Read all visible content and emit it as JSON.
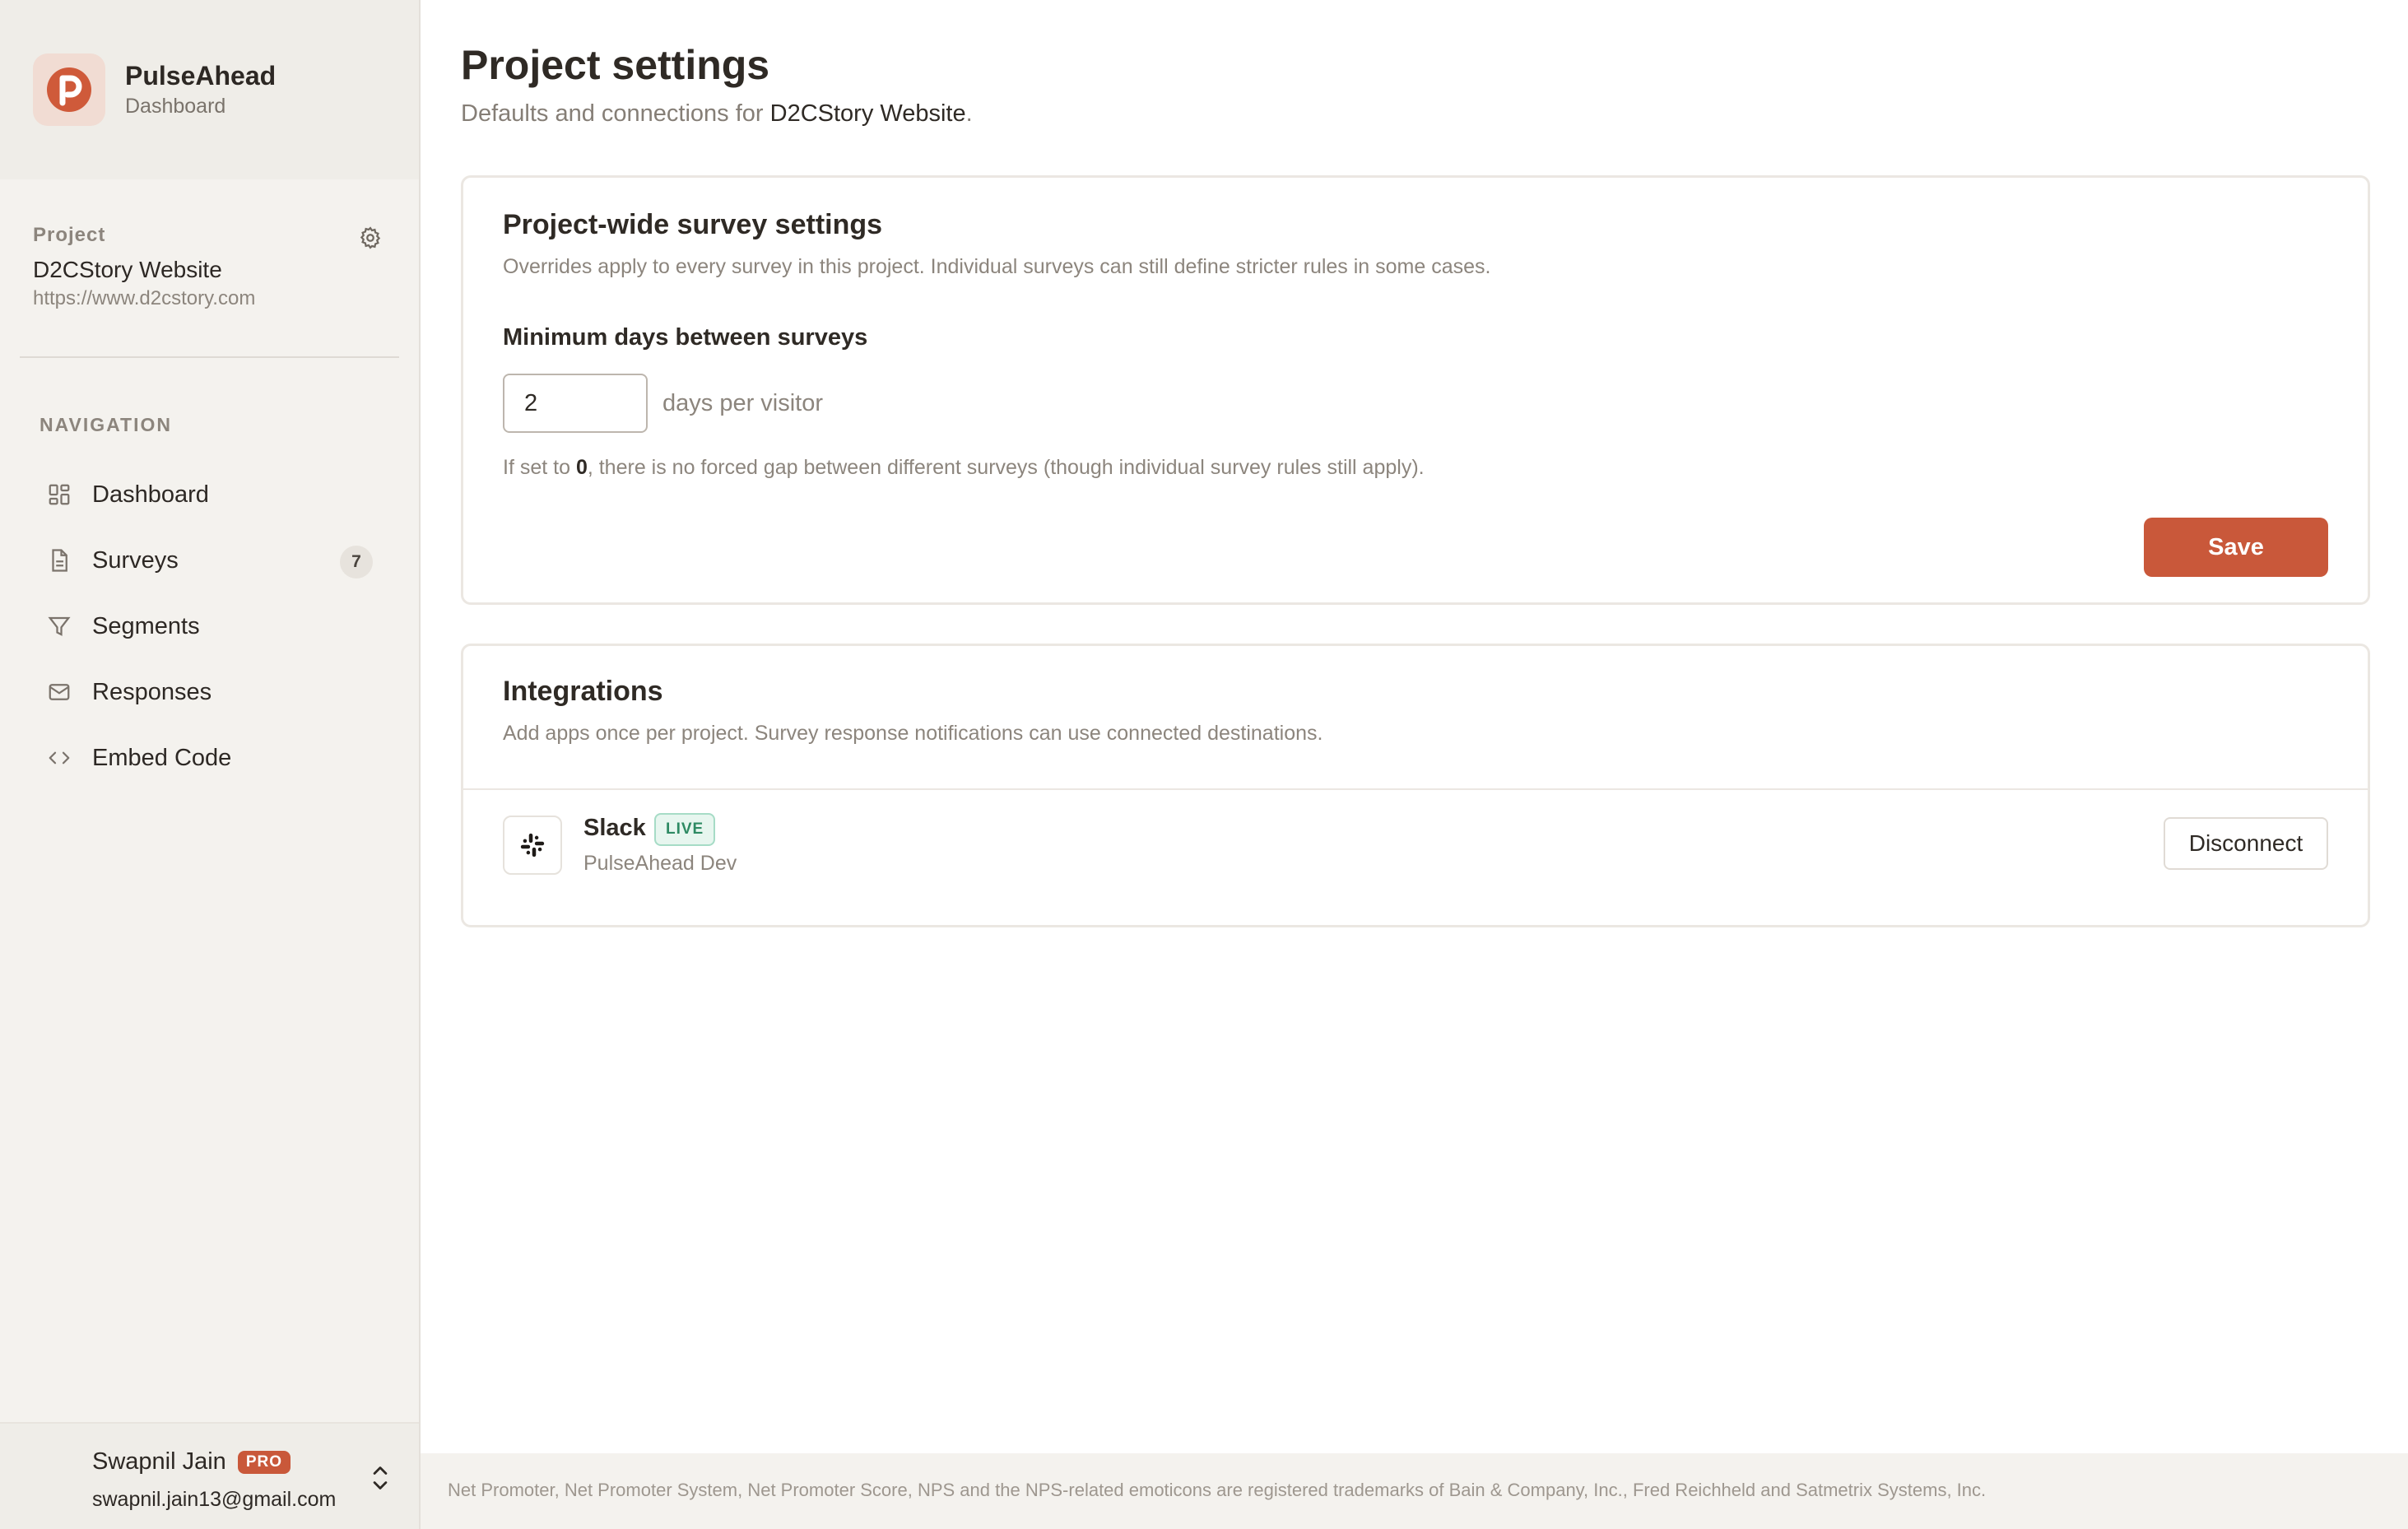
{
  "brand": {
    "name": "PulseAhead",
    "subtitle": "Dashboard"
  },
  "project": {
    "label": "Project",
    "name": "D2CStory Website",
    "url": "https://www.d2cstory.com"
  },
  "nav": {
    "heading": "NAVIGATION",
    "items": [
      {
        "label": "Dashboard",
        "icon": "grid-icon"
      },
      {
        "label": "Surveys",
        "icon": "document-icon",
        "badge": "7"
      },
      {
        "label": "Segments",
        "icon": "filter-icon"
      },
      {
        "label": "Responses",
        "icon": "mail-icon"
      },
      {
        "label": "Embed Code",
        "icon": "code-icon"
      }
    ]
  },
  "user": {
    "name": "Swapnil Jain",
    "plan": "PRO",
    "email": "swapnil.jain13@gmail.com"
  },
  "page": {
    "title": "Project settings",
    "subtitle_prefix": "Defaults and connections for ",
    "subtitle_project": "D2CStory Website",
    "subtitle_suffix": "."
  },
  "survey_settings": {
    "title": "Project-wide survey settings",
    "description": "Overrides apply to every survey in this project. Individual surveys can still define stricter rules in some cases.",
    "field_label": "Minimum days between surveys",
    "min_days_value": "2",
    "unit": "days per visitor",
    "hint_prefix": "If set to ",
    "hint_value": "0",
    "hint_suffix": ", there is no forced gap between different surveys (though individual survey rules still apply).",
    "save_label": "Save"
  },
  "integrations": {
    "title": "Integrations",
    "description": "Add apps once per project. Survey response notifications can use connected destinations.",
    "items": [
      {
        "name": "Slack",
        "status": "LIVE",
        "workspace": "PulseAhead Dev",
        "action_label": "Disconnect"
      }
    ]
  },
  "footer": {
    "text": "Net Promoter, Net Promoter System, Net Promoter Score, NPS and the NPS-related emoticons are registered trademarks of Bain & Company, Inc., Fred Reichheld and Satmetrix Systems, Inc."
  },
  "colors": {
    "accent": "#c9583a",
    "sidebar_bg": "#f4f2ee",
    "live_green": "#2e8a63"
  }
}
